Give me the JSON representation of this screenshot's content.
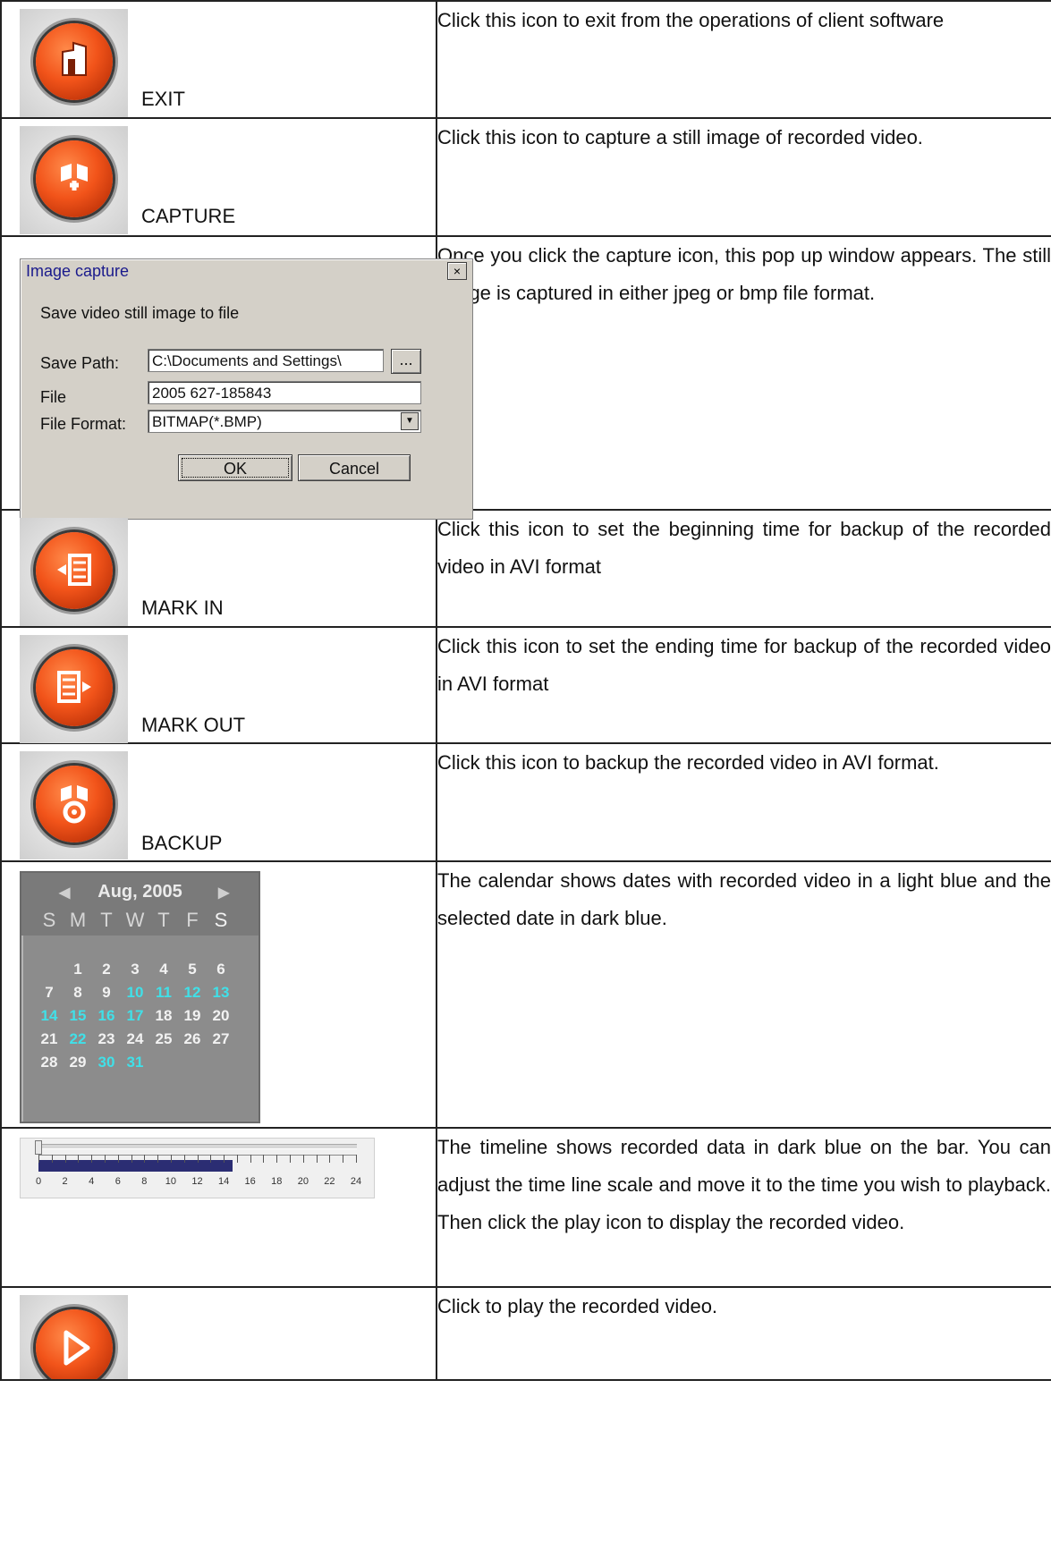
{
  "rows": [
    {
      "caption": "EXIT",
      "icon": "exit-icon",
      "description": "Click this icon to exit from the operations of client software"
    },
    {
      "caption": "CAPTURE",
      "icon": "capture-icon",
      "description": "Click this icon to capture a still image of recorded video."
    },
    {
      "description": "Once you click the capture icon, this pop up window appears. The still image is captured in either jpeg or bmp file format."
    },
    {
      "caption": "MARK IN",
      "icon": "mark-in-icon",
      "description": "Click this icon to set the beginning time for backup of the recorded video in AVI format"
    },
    {
      "caption": "MARK OUT",
      "icon": "mark-out-icon",
      "description": "Click this icon to set the ending time for backup of the recorded video in AVI format"
    },
    {
      "caption": "BACKUP",
      "icon": "backup-icon",
      "description": "Click this icon to backup the recorded video in AVI format."
    },
    {
      "description": "The calendar shows dates with recorded video in a light blue and the selected date in dark blue."
    },
    {
      "description": "The timeline shows recorded data in dark blue on the bar. You can adjust the time line scale and move it to the time you wish to playback. Then click the play icon to display the recorded video."
    },
    {
      "icon": "play-icon",
      "description": "Click to play the recorded video."
    }
  ],
  "dialog": {
    "title": "Image capture",
    "close": "×",
    "subtitle": "Save video still image to file",
    "save_path_label": "Save Path:",
    "save_path_value": "C:\\Documents and Settings\\",
    "browse_label": "...",
    "file_label": "File",
    "file_value": "2005 627-185843",
    "format_label": "File Format:",
    "format_value": "BITMAP(*.BMP)",
    "ok_label": "OK",
    "cancel_label": "Cancel"
  },
  "calendar": {
    "month_label": "Aug, 2005",
    "weekdays": [
      "S",
      "M",
      "T",
      "W",
      "T",
      "F",
      "S"
    ],
    "first_weekday": 1,
    "days_in_month": 31,
    "recorded_days": [
      10,
      11,
      12,
      13,
      14,
      15,
      16,
      17,
      22,
      30,
      31
    ],
    "colors": {
      "recorded": "#40e0e8",
      "normal": "#f2f2f2"
    }
  },
  "timeline": {
    "tick_labels": [
      "0",
      "2",
      "4",
      "6",
      "8",
      "10",
      "12",
      "14",
      "16",
      "18",
      "20",
      "22",
      "24"
    ],
    "recorded_until_hour": 14.7,
    "bar_color": "#2b2d73"
  }
}
